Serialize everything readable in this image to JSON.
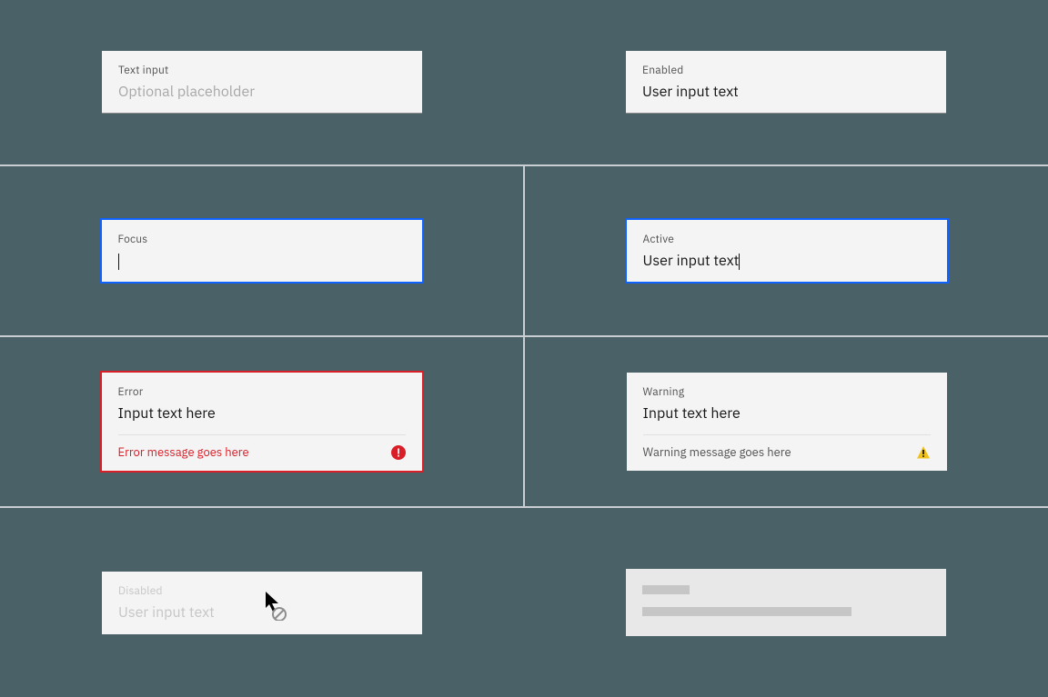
{
  "states": {
    "default": {
      "label": "Text input",
      "placeholder": "Optional placeholder",
      "value": ""
    },
    "enabled": {
      "label": "Enabled",
      "value": "User input text"
    },
    "focus": {
      "label": "Focus",
      "value": ""
    },
    "active": {
      "label": "Active",
      "value": "User input text"
    },
    "error": {
      "label": "Error",
      "value": "Input text here",
      "message": "Error message goes here"
    },
    "warning": {
      "label": "Warning",
      "value": "Input text here",
      "message": "Warning message goes here"
    },
    "disabled": {
      "label": "Disabled",
      "value": "User input text"
    },
    "skeleton": {}
  },
  "colors": {
    "focus": "#0f62fe",
    "error": "#da1e28",
    "warning": "#f1c21b",
    "background": "#4a6168",
    "field": "#f4f4f4"
  },
  "icons": {
    "error": "error-filled-icon",
    "warning": "warning-filled-icon",
    "not_allowed": "not-allowed-cursor-icon"
  }
}
